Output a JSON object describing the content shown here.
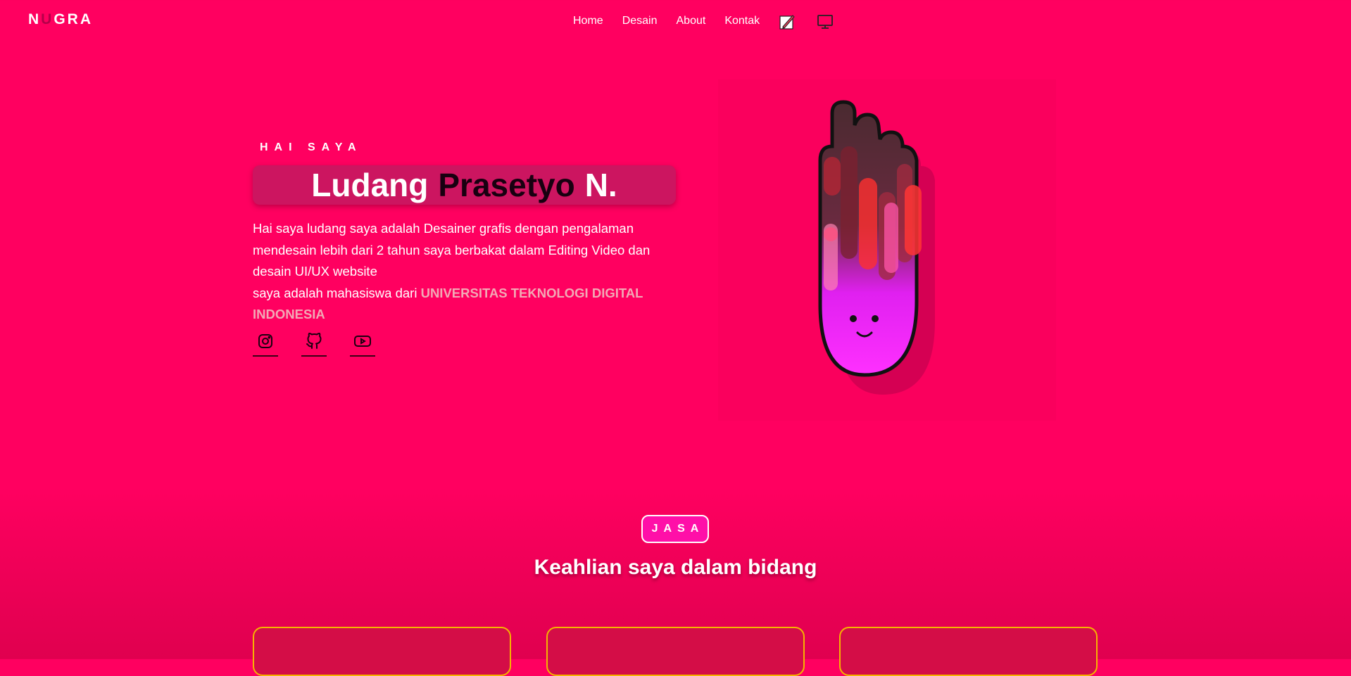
{
  "logo": {
    "first": "N",
    "accent": "U",
    "rest": "GRA"
  },
  "nav": {
    "links": [
      "Home",
      "Desain",
      "About",
      "Kontak"
    ],
    "icons": [
      "pencil-paper-icon",
      "monitor-icon"
    ]
  },
  "hero": {
    "greeting": "HAI SAYA",
    "name_first": "Ludang",
    "name_second": "Prasetyo",
    "name_third": "N.",
    "description": "Hai saya ludang saya adalah Desainer grafis dengan pengalaman mendesain lebih dari 2 tahun saya berbakat dalam Editing Video dan desain UI/UX website",
    "student_prefix": "saya adalah mahasiswa dari",
    "university": "UNIVERSITAS TEKNOLOGI DIGITAL INDONESIA",
    "socials": [
      "instagram-icon",
      "github-icon",
      "youtube-icon"
    ]
  },
  "services": {
    "badge": "JASA",
    "title": "Keahlian saya dalam bidang",
    "card_count": 3
  },
  "colors": {
    "background": "#ff0060",
    "logo_accent": "#b5004a",
    "name_box": "#cc1560",
    "university": "#f2a9b5",
    "card_border": "#f5b400",
    "badge": "#ff0fa8"
  }
}
